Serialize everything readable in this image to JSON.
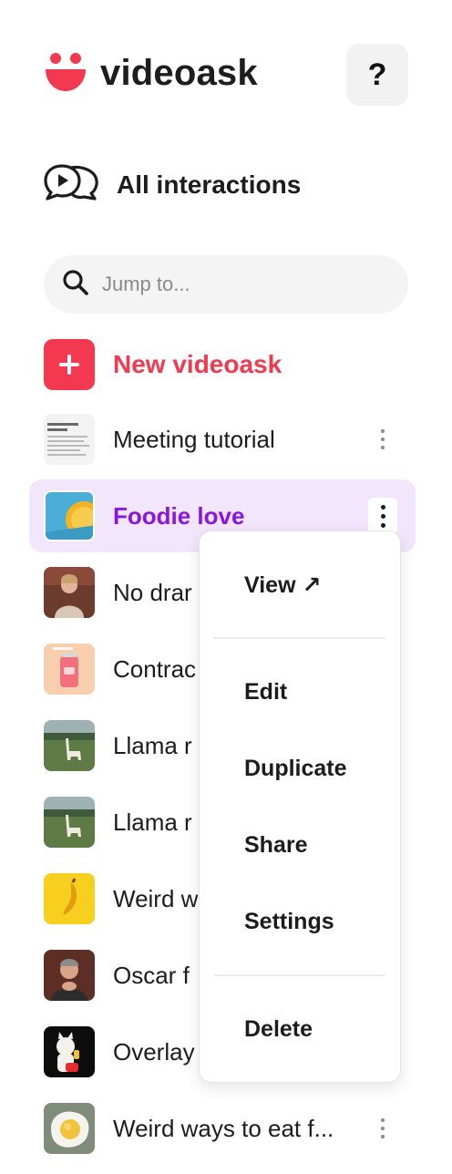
{
  "brand": {
    "name": "videoask",
    "accent": "#f2394f",
    "purple": "#8a14e0"
  },
  "header": {
    "help_label": "?",
    "help_icon": "question-mark-icon"
  },
  "nav": {
    "all_interactions": "All interactions",
    "icon": "chat-bubbles-play-icon"
  },
  "search": {
    "placeholder": "Jump to...",
    "value": ""
  },
  "new_videoask": {
    "label": "New videoask",
    "icon": "plus-icon"
  },
  "list": [
    {
      "title": "Meeting tutorial",
      "thumb": "document"
    },
    {
      "title": "Foodie love",
      "thumb": "lemon",
      "active": true
    },
    {
      "title": "No drar",
      "thumb": "person-stage"
    },
    {
      "title": "Contrac",
      "thumb": "can"
    },
    {
      "title": "Llama r",
      "thumb": "llama"
    },
    {
      "title": "Llama r",
      "thumb": "llama"
    },
    {
      "title": "Weird w",
      "thumb": "banana"
    },
    {
      "title": "Oscar f",
      "thumb": "person-clapping"
    },
    {
      "title": "Overlay",
      "thumb": "cat"
    },
    {
      "title": "Weird ways to eat f...",
      "thumb": "egg"
    }
  ],
  "context_menu": {
    "view": "View ↗",
    "edit": "Edit",
    "duplicate": "Duplicate",
    "share": "Share",
    "settings": "Settings",
    "delete": "Delete"
  }
}
